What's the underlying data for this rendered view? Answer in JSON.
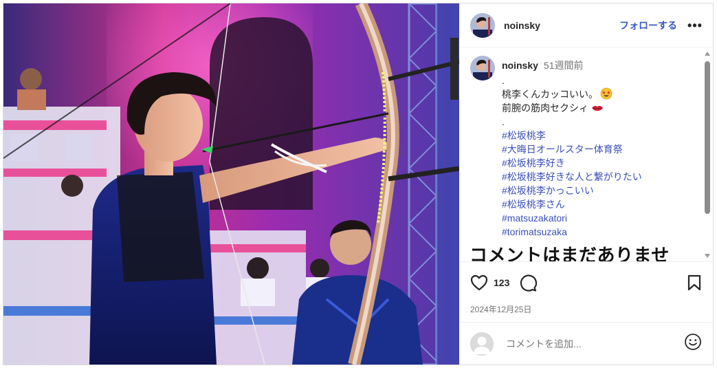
{
  "post": {
    "username": "noinsky",
    "follow_label": "フォローする",
    "more_label": "•••",
    "caption": {
      "username": "noinsky",
      "ago": "51週間前",
      "lines": [
        ".",
        "桃李くんカッコいい。",
        "前腕の筋肉セクシィ",
        "."
      ],
      "emoji_1": "star-struck-emoji",
      "emoji_2": "lips-emoji"
    },
    "hashtags": [
      "#松坂桃李",
      "#大晦日オールスター体育祭",
      "#松坂桃李好き",
      "#松坂桃李好きな人と繋がりたい",
      "#松坂桃李かっこいい",
      "#松坂桃李さん",
      "#matsuzakatori",
      "#torimatsuzaka"
    ],
    "no_comments": "コメントはまだありませ",
    "likes": "123",
    "date": "2024年12月25日",
    "comment_placeholder": "コメントを追加...",
    "icons": {
      "like": "heart-icon",
      "comment": "comment-icon",
      "save": "bookmark-icon",
      "emoji": "smiley-icon"
    },
    "colors": {
      "accent": "#3857c9",
      "hashtag": "#3b4fb8",
      "muted": "#737373"
    }
  }
}
